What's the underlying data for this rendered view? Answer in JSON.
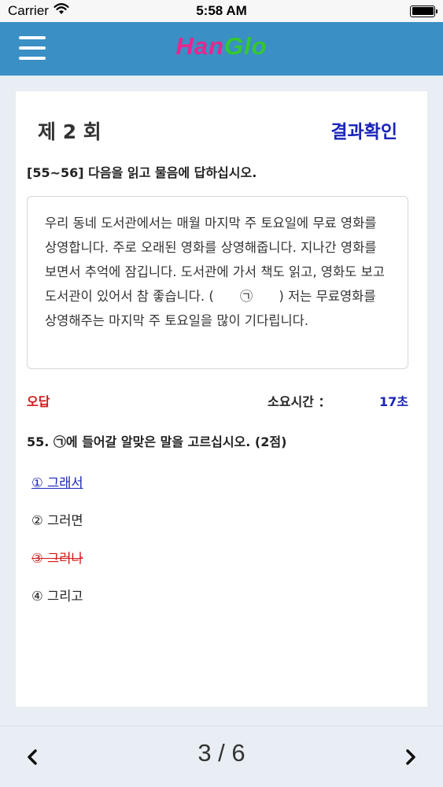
{
  "status_bar": {
    "carrier": "Carrier",
    "time": "5:58 AM"
  },
  "header": {
    "logo_part1": "Han",
    "logo_part2": "Glo",
    "brand_colors": {
      "han": "#e8268f",
      "glo": "#35c82f",
      "bar": "#3a8fc4"
    },
    "menu_icon": "hamburger-icon"
  },
  "card": {
    "round_title": "제 2 회",
    "result_link": "결과확인",
    "instruction": "[55~56] 다음을 읽고 물음에 답하십시오.",
    "passage": "우리 동네 도서관에서는 매월 마지막 주 토요일에 무료 영화를 상영합니다. 주로 오래된 영화를 상영해줍니다. 지나간 영화를 보면서 추억에 잠깁니다. 도서관에 가서 책도 읽고, 영화도 보고 도서관이 있어서 참 좋습니다. (　　㉠　　) 저는 무료영화를 상영해주는 마지막 주 토요일을 많이 기다립니다.",
    "status": "오답",
    "time_label": "소요시간 ：",
    "time_value": "17초",
    "question": "55. ㉠에 들어갈 알맞은 말을 고르십시오. (2점)",
    "options": [
      {
        "label": "① 그래서",
        "state": "correct"
      },
      {
        "label": "② 그러면",
        "state": "normal"
      },
      {
        "label": "③ 그러나",
        "state": "wrong"
      },
      {
        "label": "④ 그리고",
        "state": "normal"
      }
    ],
    "colors": {
      "correct": "#1a24b8",
      "wrong": "#d01818"
    }
  },
  "footer": {
    "page_indicator": "3 / 6",
    "prev_icon": "chevron-left-icon",
    "next_icon": "chevron-right-icon"
  }
}
